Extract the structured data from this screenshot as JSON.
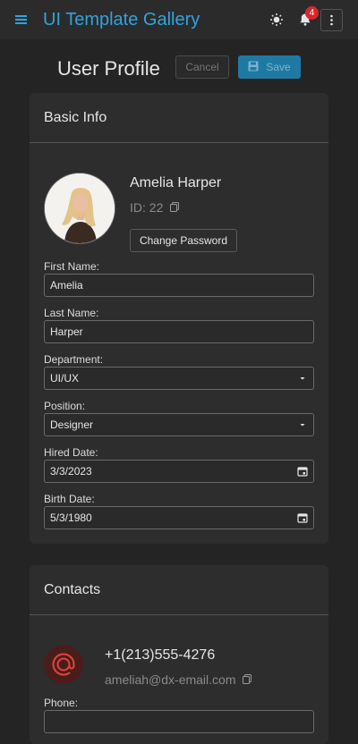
{
  "app": {
    "title": "UI Template Gallery",
    "notification_count": "4"
  },
  "icons": {
    "menu": "menu-icon",
    "theme": "sun-icon",
    "bell": "bell-icon",
    "more": "more-vertical-icon",
    "save": "floppy-disk-icon",
    "copy": "copy-icon",
    "calendar": "calendar-icon",
    "dropdown": "chevron-down-icon",
    "email": "at-sign-icon"
  },
  "colors": {
    "accent": "#2fa4de",
    "badge": "#d9262c",
    "save_bg": "#1f7aa3",
    "email_icon": "#e0463c"
  },
  "page": {
    "title": "User Profile",
    "cancel_label": "Cancel",
    "save_label": "Save"
  },
  "basic_info": {
    "header": "Basic Info",
    "name": "Amelia Harper",
    "id_text": "ID: 22",
    "change_password_label": "Change Password",
    "fields": {
      "first_name": {
        "label": "First Name:",
        "value": "Amelia"
      },
      "last_name": {
        "label": "Last Name:",
        "value": "Harper"
      },
      "department": {
        "label": "Department:",
        "value": "UI/UX"
      },
      "position": {
        "label": "Position:",
        "value": "Designer"
      },
      "hired_date": {
        "label": "Hired Date:",
        "value": "3/3/2023"
      },
      "birth_date": {
        "label": "Birth Date:",
        "value": "5/3/1980"
      }
    }
  },
  "contacts": {
    "header": "Contacts",
    "phone": "+1(213)555-4276",
    "email": "ameliah@dx-email.com",
    "phone_label": "Phone:"
  }
}
